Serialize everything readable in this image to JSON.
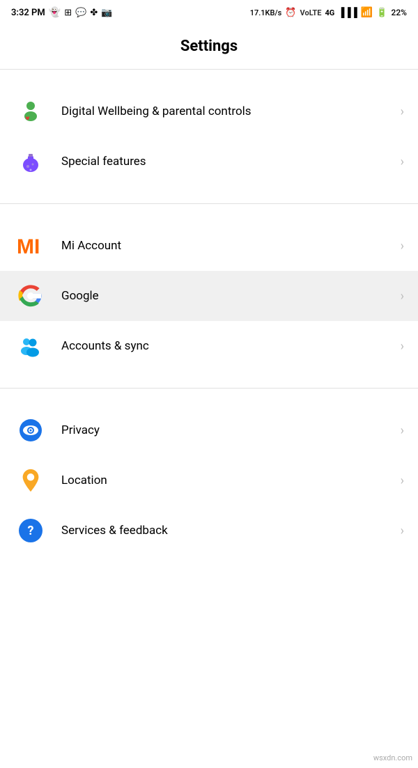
{
  "statusBar": {
    "time": "3:32 PM",
    "network": "17.1KB/s",
    "battery": "22%",
    "batteryIcon": "🔋"
  },
  "page": {
    "title": "Settings"
  },
  "sections": [
    {
      "id": "section1",
      "items": [
        {
          "id": "digital-wellbeing",
          "label": "Digital Wellbeing & parental controls",
          "icon": "wellbeing",
          "highlighted": false
        },
        {
          "id": "special-features",
          "label": "Special features",
          "icon": "special",
          "highlighted": false
        }
      ]
    },
    {
      "id": "section2",
      "items": [
        {
          "id": "mi-account",
          "label": "Mi Account",
          "icon": "mi",
          "highlighted": false
        },
        {
          "id": "google",
          "label": "Google",
          "icon": "google",
          "highlighted": true
        },
        {
          "id": "accounts-sync",
          "label": "Accounts & sync",
          "icon": "accounts",
          "highlighted": false
        }
      ]
    },
    {
      "id": "section3",
      "items": [
        {
          "id": "privacy",
          "label": "Privacy",
          "icon": "privacy",
          "highlighted": false
        },
        {
          "id": "location",
          "label": "Location",
          "icon": "location",
          "highlighted": false
        },
        {
          "id": "services-feedback",
          "label": "Services & feedback",
          "icon": "services",
          "highlighted": false
        }
      ]
    }
  ],
  "watermark": "wsxdn.com"
}
